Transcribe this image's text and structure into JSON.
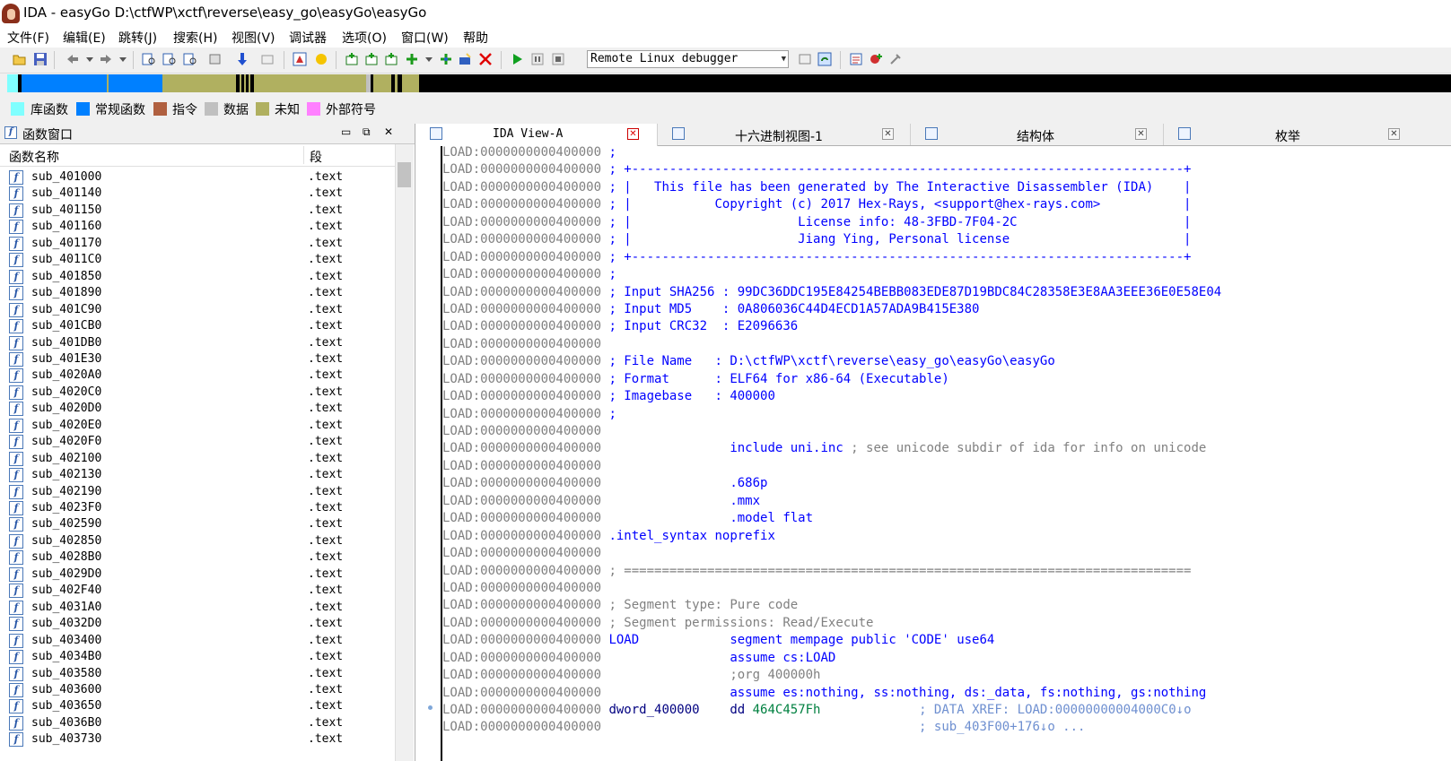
{
  "title_bar": {
    "text": "IDA - easyGo D:\\ctfWP\\xctf\\reverse\\easy_go\\easyGo\\easyGo"
  },
  "menu": [
    "文件(F)",
    "编辑(E)",
    "跳转(J)",
    "搜索(H)",
    "视图(V)",
    "调试器",
    "选项(O)",
    "窗口(W)",
    "帮助"
  ],
  "toolbar": {
    "debugger_select": "Remote Linux debugger",
    "icons": [
      "open-icon",
      "save-icon",
      "back-icon",
      "back-menu-icon",
      "forward-icon",
      "forward-menu-icon",
      "search-text-icon",
      "search-binary-icon",
      "search-immediate-icon",
      "find-icon",
      "jump-down-icon",
      "jump-address-icon",
      "flowchart-icon",
      "calls-icon",
      "struct-icon",
      "enum-icon",
      "add-icon",
      "create-icon",
      "make-data-icon",
      "node-icon",
      "close-red-icon",
      "run-icon",
      "pause-icon",
      "stop-icon",
      "attach-icon",
      "detach-icon",
      "breakpoint-icon",
      "step-icon",
      "options-icon"
    ]
  },
  "legend": [
    {
      "label": "库函数",
      "color": "#80ffff"
    },
    {
      "label": "常规函数",
      "color": "#0080ff"
    },
    {
      "label": "指令",
      "color": "#b06040"
    },
    {
      "label": "数据",
      "color": "#c0c0c0"
    },
    {
      "label": "未知",
      "color": "#b0b060"
    },
    {
      "label": "外部符号",
      "color": "#ff80ff"
    }
  ],
  "functions_window": {
    "title": "函数窗口",
    "col_name": "函数名称",
    "col_segment": "段",
    "items": [
      {
        "name": "sub_401000",
        "seg": ".text"
      },
      {
        "name": "sub_401140",
        "seg": ".text"
      },
      {
        "name": "sub_401150",
        "seg": ".text"
      },
      {
        "name": "sub_401160",
        "seg": ".text"
      },
      {
        "name": "sub_401170",
        "seg": ".text"
      },
      {
        "name": "sub_4011C0",
        "seg": ".text"
      },
      {
        "name": "sub_401850",
        "seg": ".text"
      },
      {
        "name": "sub_401890",
        "seg": ".text"
      },
      {
        "name": "sub_401C90",
        "seg": ".text"
      },
      {
        "name": "sub_401CB0",
        "seg": ".text"
      },
      {
        "name": "sub_401DB0",
        "seg": ".text"
      },
      {
        "name": "sub_401E30",
        "seg": ".text"
      },
      {
        "name": "sub_4020A0",
        "seg": ".text"
      },
      {
        "name": "sub_4020C0",
        "seg": ".text"
      },
      {
        "name": "sub_4020D0",
        "seg": ".text"
      },
      {
        "name": "sub_4020E0",
        "seg": ".text"
      },
      {
        "name": "sub_4020F0",
        "seg": ".text"
      },
      {
        "name": "sub_402100",
        "seg": ".text"
      },
      {
        "name": "sub_402130",
        "seg": ".text"
      },
      {
        "name": "sub_402190",
        "seg": ".text"
      },
      {
        "name": "sub_4023F0",
        "seg": ".text"
      },
      {
        "name": "sub_402590",
        "seg": ".text"
      },
      {
        "name": "sub_402850",
        "seg": ".text"
      },
      {
        "name": "sub_4028B0",
        "seg": ".text"
      },
      {
        "name": "sub_4029D0",
        "seg": ".text"
      },
      {
        "name": "sub_402F40",
        "seg": ".text"
      },
      {
        "name": "sub_4031A0",
        "seg": ".text"
      },
      {
        "name": "sub_4032D0",
        "seg": ".text"
      },
      {
        "name": "sub_403400",
        "seg": ".text"
      },
      {
        "name": "sub_4034B0",
        "seg": ".text"
      },
      {
        "name": "sub_403580",
        "seg": ".text"
      },
      {
        "name": "sub_403600",
        "seg": ".text"
      },
      {
        "name": "sub_403650",
        "seg": ".text"
      },
      {
        "name": "sub_4036B0",
        "seg": ".text"
      },
      {
        "name": "sub_403730",
        "seg": ".text"
      }
    ]
  },
  "tabs": [
    {
      "label": "IDA View-A",
      "active": true
    },
    {
      "label": "十六进制视图-1",
      "active": false
    },
    {
      "label": "结构体",
      "active": false
    },
    {
      "label": "枚举",
      "active": false
    }
  ],
  "disassembly": {
    "address": "LOAD:0000000000400000",
    "lines": [
      [
        [
          "c-blue",
          ";"
        ]
      ],
      [
        [
          "c-blue",
          "; +-------------------------------------------------------------------------+"
        ]
      ],
      [
        [
          "c-blue",
          "; |   This file has been generated by The Interactive Disassembler (IDA)    |"
        ]
      ],
      [
        [
          "c-blue",
          "; |           Copyright (c) 2017 Hex-Rays, <support@hex-rays.com>           |"
        ]
      ],
      [
        [
          "c-blue",
          "; |                      License info: 48-3FBD-7F04-2C                      |"
        ]
      ],
      [
        [
          "c-blue",
          "; |                      Jiang Ying, Personal license                       |"
        ]
      ],
      [
        [
          "c-blue",
          "; +-------------------------------------------------------------------------+"
        ]
      ],
      [
        [
          "c-blue",
          ";"
        ]
      ],
      [
        [
          "c-blue",
          "; Input SHA256 : 99DC36DDC195E84254BEBB083EDE87D19BDC84C28358E3E8AA3EEE36E0E58E04"
        ]
      ],
      [
        [
          "c-blue",
          "; Input MD5    : 0A806036C44D4ECD1A57ADA9B415E380"
        ]
      ],
      [
        [
          "c-blue",
          "; Input CRC32  : E2096636"
        ]
      ],
      [],
      [
        [
          "c-blue",
          "; File Name   : D:\\ctfWP\\xctf\\reverse\\easy_go\\easyGo\\easyGo"
        ]
      ],
      [
        [
          "c-blue",
          "; Format      : ELF64 for x86-64 (Executable)"
        ]
      ],
      [
        [
          "c-blue",
          "; Imagebase   : 400000"
        ]
      ],
      [
        [
          "c-blue",
          ";"
        ]
      ],
      [],
      [
        [
          "",
          "                "
        ],
        [
          "c-blue",
          "include uni.inc"
        ],
        [
          "c-gray",
          " ; see unicode subdir of ida for info on unicode"
        ]
      ],
      [],
      [
        [
          "",
          "                "
        ],
        [
          "c-blue",
          ".686p"
        ]
      ],
      [
        [
          "",
          "                "
        ],
        [
          "c-blue",
          ".mmx"
        ]
      ],
      [
        [
          "",
          "                "
        ],
        [
          "c-blue",
          ".model flat"
        ]
      ],
      [
        [
          "c-blue",
          ".intel_syntax noprefix"
        ]
      ],
      [],
      [
        [
          "c-gray",
          "; ==========================================================================="
        ]
      ],
      [],
      [
        [
          "c-gray",
          "; Segment type: Pure code"
        ]
      ],
      [
        [
          "c-gray",
          "; Segment permissions: Read/Execute"
        ]
      ],
      [
        [
          "c-blue",
          "LOAD"
        ],
        [
          "",
          "            "
        ],
        [
          "c-blue",
          "segment mempage public 'CODE' use64"
        ]
      ],
      [
        [
          "",
          "                "
        ],
        [
          "c-blue",
          "assume cs:LOAD"
        ]
      ],
      [
        [
          "",
          "                "
        ],
        [
          "c-gray",
          ";org 400000h"
        ]
      ],
      [
        [
          "",
          "                "
        ],
        [
          "c-blue",
          "assume es:nothing, ss:nothing, ds:_data, fs:nothing, gs:nothing"
        ]
      ],
      [
        [
          "c-navy",
          "dword_400000"
        ],
        [
          "",
          "    "
        ],
        [
          "c-navy",
          "dd "
        ],
        [
          "c-green",
          "464C457Fh"
        ],
        [
          "",
          "             "
        ],
        [
          "c-lblue",
          "; DATA XREF: LOAD:00000000004000C0↓o"
        ]
      ],
      [
        [
          "",
          "                                         "
        ],
        [
          "c-lblue",
          "; sub_403F00+176↓o ..."
        ]
      ]
    ]
  }
}
